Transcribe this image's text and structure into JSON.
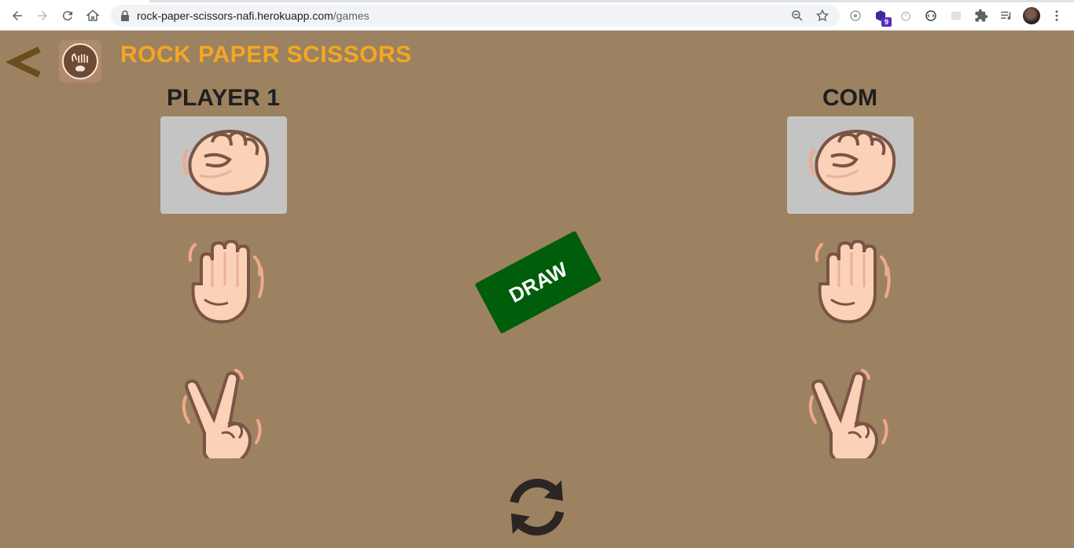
{
  "browser": {
    "url_host": "rock-paper-scissors-nafi.herokuapp.com",
    "url_path": "/games",
    "extension_badge": "9"
  },
  "header": {
    "title": "ROCK PAPER SCISSORS",
    "back_icon": "chevron-left-icon",
    "logo_icon": "rps-logo-icon"
  },
  "player": {
    "label": "PLAYER 1",
    "selected": "rock",
    "choices": [
      "rock",
      "paper",
      "scissors"
    ]
  },
  "computer": {
    "label": "COM",
    "selected": "rock",
    "choices": [
      "rock",
      "paper",
      "scissors"
    ]
  },
  "result": {
    "text": "DRAW",
    "color": "#005d0b"
  },
  "controls": {
    "refresh_icon": "refresh-icon"
  },
  "colors": {
    "background": "#9c8260",
    "title": "#f5a623",
    "selected_slot": "#c4c4c4"
  }
}
